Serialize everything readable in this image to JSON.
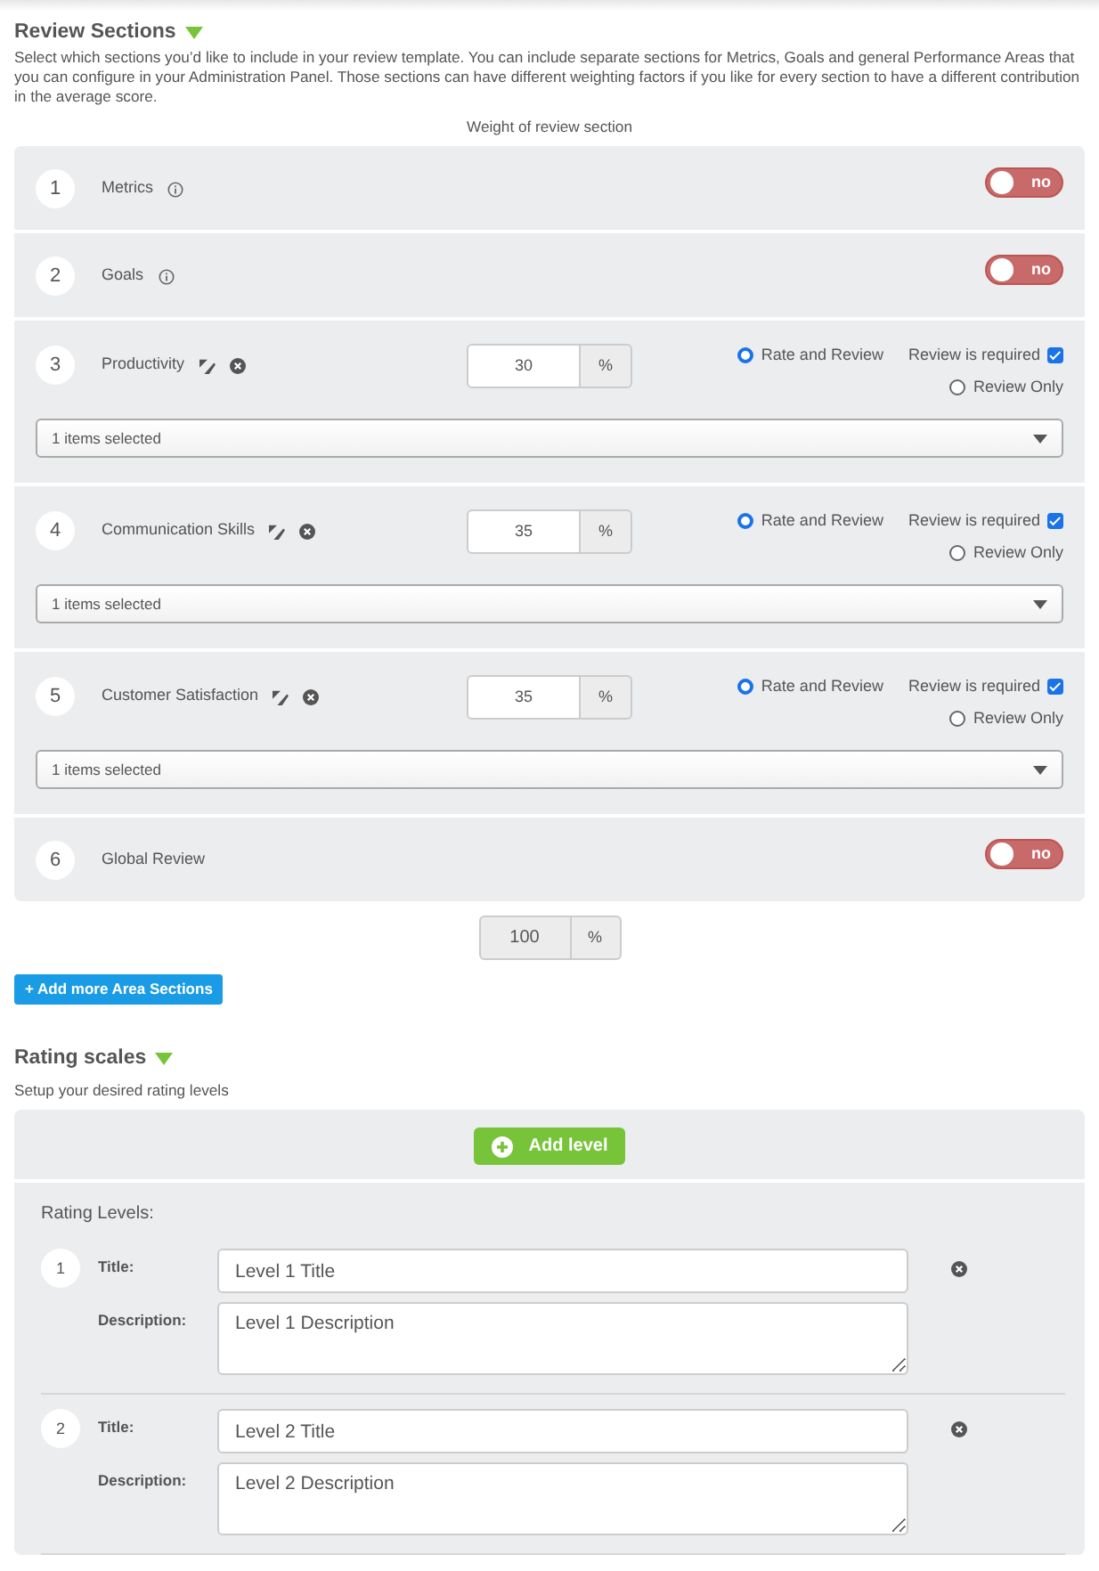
{
  "review": {
    "title": "Review Sections",
    "description": "Select which sections you’d like to include in your review template. You can include separate sections for Metrics, Goals and general Performance Areas that you can configure in your Administration Panel. Those sections can have different weighting factors if you like for every section to have a different contribution in the average score.",
    "weight_label": "Weight of review section"
  },
  "sections": [
    {
      "number": "1",
      "name": "Metrics",
      "kind": "toggle",
      "info": true,
      "toggle_label": "no",
      "on": false
    },
    {
      "number": "2",
      "name": "Goals",
      "kind": "toggle",
      "info": true,
      "toggle_label": "no",
      "on": false
    },
    {
      "number": "3",
      "name": "Productivity",
      "kind": "weighted",
      "weight": "30",
      "unit": "%",
      "options": [
        {
          "label": "Rate and Review",
          "selected": true
        },
        {
          "label": "Review Only",
          "selected": false
        }
      ],
      "required_label": "Review is required",
      "required": true,
      "dropdown": "1 items selected"
    },
    {
      "number": "4",
      "name": "Communication Skills",
      "kind": "weighted",
      "weight": "35",
      "unit": "%",
      "options": [
        {
          "label": "Rate and Review",
          "selected": true
        },
        {
          "label": "Review Only",
          "selected": false
        }
      ],
      "required_label": "Review is required",
      "required": true,
      "dropdown": "1 items selected"
    },
    {
      "number": "5",
      "name": "Customer Satisfaction",
      "kind": "weighted",
      "weight": "35",
      "unit": "%",
      "options": [
        {
          "label": "Rate and Review",
          "selected": true
        },
        {
          "label": "Review Only",
          "selected": false
        }
      ],
      "required_label": "Review is required",
      "required": true,
      "dropdown": "1 items selected"
    },
    {
      "number": "6",
      "name": "Global Review",
      "kind": "toggle",
      "info": false,
      "toggle_label": "no",
      "on": false
    }
  ],
  "total": {
    "value": "100",
    "unit": "%"
  },
  "add_sections_button": "+ Add more Area Sections",
  "rating": {
    "title": "Rating scales",
    "description": "Setup your desired rating levels",
    "add_button": "Add level",
    "levels_label": "Rating Levels:",
    "levels": [
      {
        "number": "1",
        "title_label": "Title:",
        "title_value": "Level 1 Title",
        "description_label": "Description:",
        "description_value": "Level 1 Description"
      },
      {
        "number": "2",
        "title_label": "Title:",
        "title_value": "Level 2 Title",
        "description_label": "Description:",
        "description_value": "Level 2 Description"
      }
    ]
  }
}
